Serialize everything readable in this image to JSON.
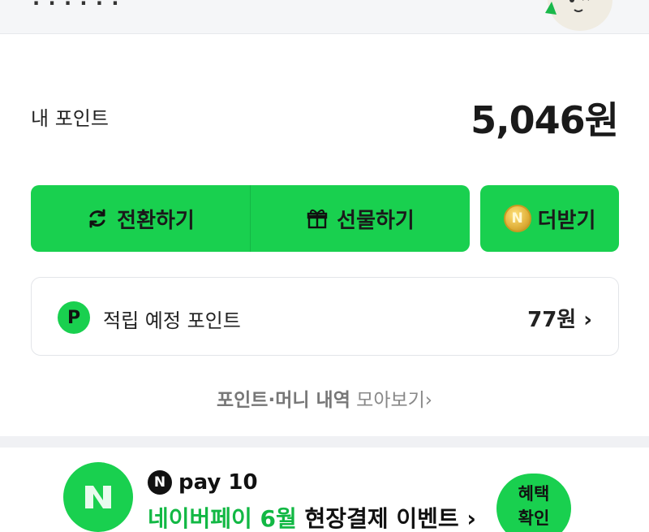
{
  "points": {
    "label": "내 포인트",
    "value": "5,046원"
  },
  "actions": {
    "convert_label": "전환하기",
    "gift_label": "선물하기",
    "more_label": "더받기",
    "coin_glyph": "N"
  },
  "expected": {
    "badge": "P",
    "label": "적립 예정 포인트",
    "value": "77원 ›"
  },
  "history": {
    "strong": "포인트·머니 내역",
    "rest": " 모아보기›"
  },
  "promo": {
    "n_glyph": "N",
    "pay_label": "pay 10",
    "title_green": "네이버페이 6월",
    "title_dark": " 현장결제 이벤트 ›",
    "btn_line1": "혜택",
    "btn_line2": "확인"
  },
  "colors": {
    "accent": "#19d04f",
    "accent_text": "#12b844"
  },
  "icons": [
    "refresh-icon",
    "gift-icon",
    "coin-icon",
    "point-badge-icon",
    "chevron-right-icon",
    "npay-logo-icon",
    "mascot-icon"
  ]
}
